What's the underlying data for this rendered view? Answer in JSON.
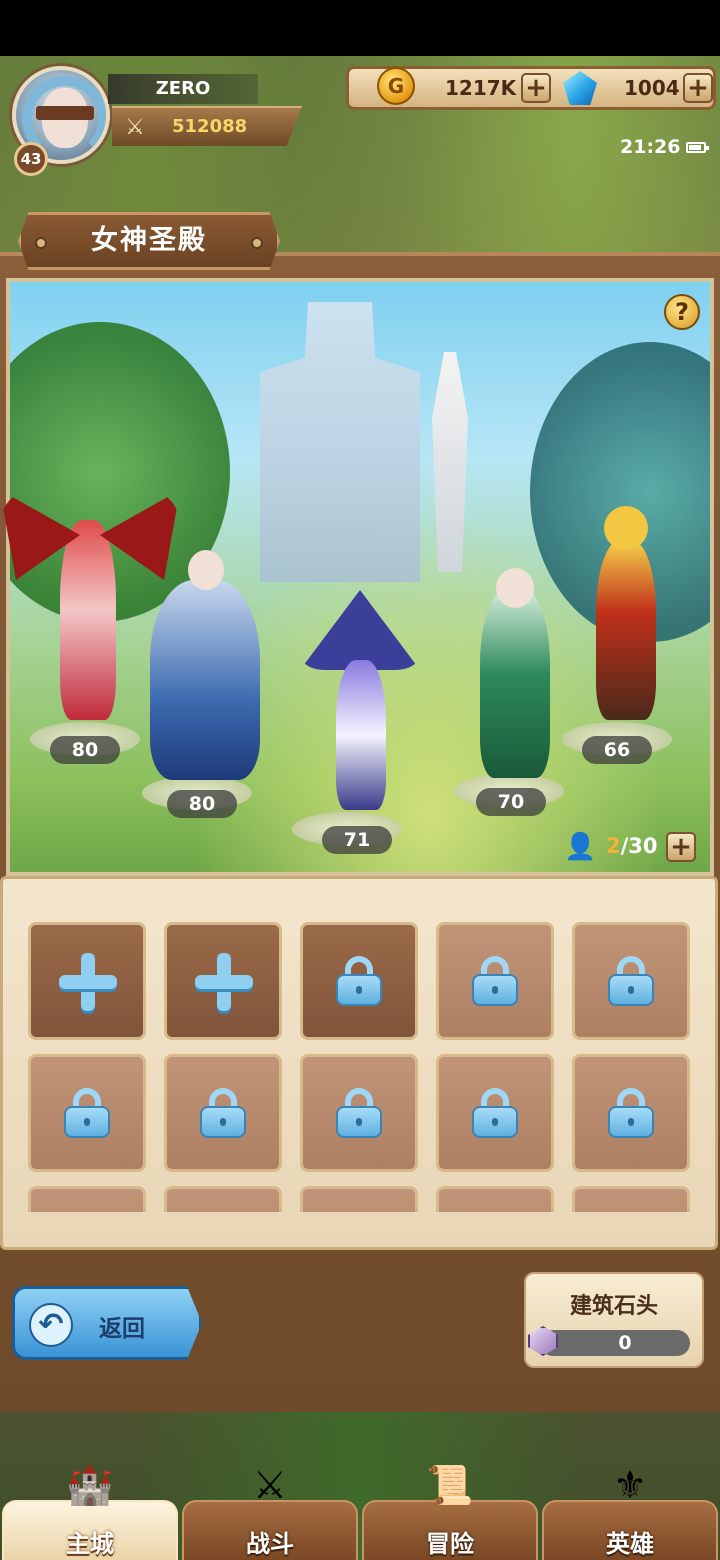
{
  "player": {
    "name": "ZERO",
    "level": "43",
    "power": "512088"
  },
  "currency": {
    "gold": "1217K",
    "gems": "1004"
  },
  "status": {
    "time": "21:26"
  },
  "building": {
    "title": "女神圣殿"
  },
  "heroes": [
    {
      "level": "80"
    },
    {
      "level": "80"
    },
    {
      "level": "71"
    },
    {
      "level": "70"
    },
    {
      "level": "66"
    }
  ],
  "capacity": {
    "current": "2",
    "max": "/30"
  },
  "slots": [
    {
      "state": "add"
    },
    {
      "state": "add"
    },
    {
      "state": "locked"
    },
    {
      "state": "locked"
    },
    {
      "state": "locked"
    },
    {
      "state": "locked"
    },
    {
      "state": "locked"
    },
    {
      "state": "locked"
    },
    {
      "state": "locked"
    },
    {
      "state": "locked"
    },
    {
      "state": "locked"
    },
    {
      "state": "locked"
    },
    {
      "state": "locked"
    },
    {
      "state": "locked"
    },
    {
      "state": "locked"
    }
  ],
  "actions": {
    "back_label": "返回"
  },
  "resource": {
    "title": "建筑石头",
    "value": "0"
  },
  "nav": [
    {
      "label": "主城",
      "icon": "castle-icon",
      "active": true
    },
    {
      "label": "战斗",
      "icon": "crossed-swords-icon",
      "active": false
    },
    {
      "label": "冒险",
      "icon": "scroll-icon",
      "active": false
    },
    {
      "label": "英雄",
      "icon": "hero-crest-icon",
      "active": false
    }
  ],
  "colors": {
    "accent_gold": "#f8d66a",
    "panel_brown": "#8a5f3a",
    "back_button_blue": "#3a93d6",
    "capacity_current": "#f7b23a"
  }
}
